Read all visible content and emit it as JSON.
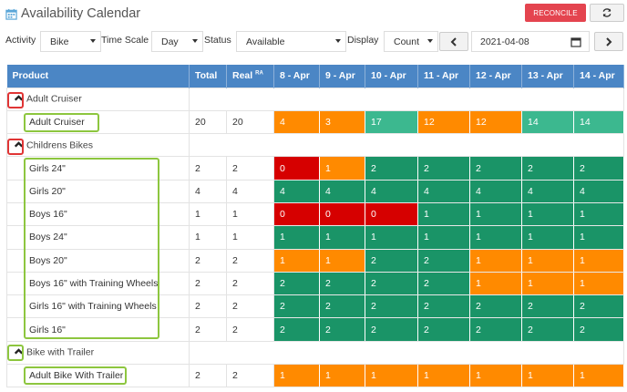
{
  "header": {
    "title": "Availability Calendar",
    "reconcile_label": "RECONCILE"
  },
  "filters": {
    "activity_label": "Activity",
    "activity_value": "Bike",
    "timescale_label": "Time Scale",
    "timescale_value": "Day",
    "status_label": "Status",
    "status_value": "Available",
    "display_label": "Display",
    "display_value": "Count",
    "date_value": "2021-04-08"
  },
  "columns": {
    "product": "Product",
    "total": "Total",
    "real": "Real",
    "real_sup": "RA",
    "dates": [
      "8 - Apr",
      "9 - Apr",
      "10 - Apr",
      "11 - Apr",
      "12 - Apr",
      "13 - Apr",
      "14 - Apr"
    ]
  },
  "colors": {
    "header": "#4b86c5",
    "orange": "#ff8a00",
    "green": "#1a9467",
    "teal": "#3cb88f",
    "red": "#d60000",
    "outline_green": "#8dc63f",
    "outline_red": "#e03535"
  },
  "groups": [
    {
      "name": "Adult Cruiser",
      "chevron": "red",
      "products": [
        {
          "name": "Adult Cruiser",
          "total": "20",
          "real": "20",
          "days": [
            {
              "v": "4",
              "c": "orange"
            },
            {
              "v": "3",
              "c": "orange"
            },
            {
              "v": "17",
              "c": "teal"
            },
            {
              "v": "12",
              "c": "orange"
            },
            {
              "v": "12",
              "c": "orange"
            },
            {
              "v": "14",
              "c": "teal"
            },
            {
              "v": "14",
              "c": "teal"
            }
          ]
        }
      ]
    },
    {
      "name": "Childrens Bikes",
      "chevron": "red",
      "products": [
        {
          "name": "Girls 24\"",
          "total": "2",
          "real": "2",
          "days": [
            {
              "v": "0",
              "c": "red"
            },
            {
              "v": "1",
              "c": "orange"
            },
            {
              "v": "2",
              "c": "green"
            },
            {
              "v": "2",
              "c": "green"
            },
            {
              "v": "2",
              "c": "green"
            },
            {
              "v": "2",
              "c": "green"
            },
            {
              "v": "2",
              "c": "green"
            }
          ]
        },
        {
          "name": "Girls 20\"",
          "total": "4",
          "real": "4",
          "days": [
            {
              "v": "4",
              "c": "green"
            },
            {
              "v": "4",
              "c": "green"
            },
            {
              "v": "4",
              "c": "green"
            },
            {
              "v": "4",
              "c": "green"
            },
            {
              "v": "4",
              "c": "green"
            },
            {
              "v": "4",
              "c": "green"
            },
            {
              "v": "4",
              "c": "green"
            }
          ]
        },
        {
          "name": "Boys 16\"",
          "total": "1",
          "real": "1",
          "days": [
            {
              "v": "0",
              "c": "red"
            },
            {
              "v": "0",
              "c": "red"
            },
            {
              "v": "0",
              "c": "red"
            },
            {
              "v": "1",
              "c": "green"
            },
            {
              "v": "1",
              "c": "green"
            },
            {
              "v": "1",
              "c": "green"
            },
            {
              "v": "1",
              "c": "green"
            }
          ]
        },
        {
          "name": "Boys 24\"",
          "total": "1",
          "real": "1",
          "days": [
            {
              "v": "1",
              "c": "green"
            },
            {
              "v": "1",
              "c": "green"
            },
            {
              "v": "1",
              "c": "green"
            },
            {
              "v": "1",
              "c": "green"
            },
            {
              "v": "1",
              "c": "green"
            },
            {
              "v": "1",
              "c": "green"
            },
            {
              "v": "1",
              "c": "green"
            }
          ]
        },
        {
          "name": "Boys 20\"",
          "total": "2",
          "real": "2",
          "days": [
            {
              "v": "1",
              "c": "orange"
            },
            {
              "v": "1",
              "c": "orange"
            },
            {
              "v": "2",
              "c": "green"
            },
            {
              "v": "2",
              "c": "green"
            },
            {
              "v": "1",
              "c": "orange"
            },
            {
              "v": "1",
              "c": "orange"
            },
            {
              "v": "1",
              "c": "orange"
            }
          ]
        },
        {
          "name": "Boys 16\" with Training Wheels",
          "total": "2",
          "real": "2",
          "days": [
            {
              "v": "2",
              "c": "green"
            },
            {
              "v": "2",
              "c": "green"
            },
            {
              "v": "2",
              "c": "green"
            },
            {
              "v": "2",
              "c": "green"
            },
            {
              "v": "1",
              "c": "orange"
            },
            {
              "v": "1",
              "c": "orange"
            },
            {
              "v": "1",
              "c": "orange"
            }
          ]
        },
        {
          "name": "Girls 16\" with Training Wheels",
          "total": "2",
          "real": "2",
          "days": [
            {
              "v": "2",
              "c": "green"
            },
            {
              "v": "2",
              "c": "green"
            },
            {
              "v": "2",
              "c": "green"
            },
            {
              "v": "2",
              "c": "green"
            },
            {
              "v": "2",
              "c": "green"
            },
            {
              "v": "2",
              "c": "green"
            },
            {
              "v": "2",
              "c": "green"
            }
          ]
        },
        {
          "name": "Girls 16\"",
          "total": "2",
          "real": "2",
          "days": [
            {
              "v": "2",
              "c": "green"
            },
            {
              "v": "2",
              "c": "green"
            },
            {
              "v": "2",
              "c": "green"
            },
            {
              "v": "2",
              "c": "green"
            },
            {
              "v": "2",
              "c": "green"
            },
            {
              "v": "2",
              "c": "green"
            },
            {
              "v": "2",
              "c": "green"
            }
          ]
        }
      ]
    },
    {
      "name": "Bike with Trailer",
      "chevron": "green",
      "products": [
        {
          "name": "Adult Bike With Trailer",
          "total": "2",
          "real": "2",
          "days": [
            {
              "v": "1",
              "c": "orange"
            },
            {
              "v": "1",
              "c": "orange"
            },
            {
              "v": "1",
              "c": "orange"
            },
            {
              "v": "1",
              "c": "orange"
            },
            {
              "v": "1",
              "c": "orange"
            },
            {
              "v": "1",
              "c": "orange"
            },
            {
              "v": "1",
              "c": "orange"
            }
          ]
        }
      ]
    }
  ]
}
